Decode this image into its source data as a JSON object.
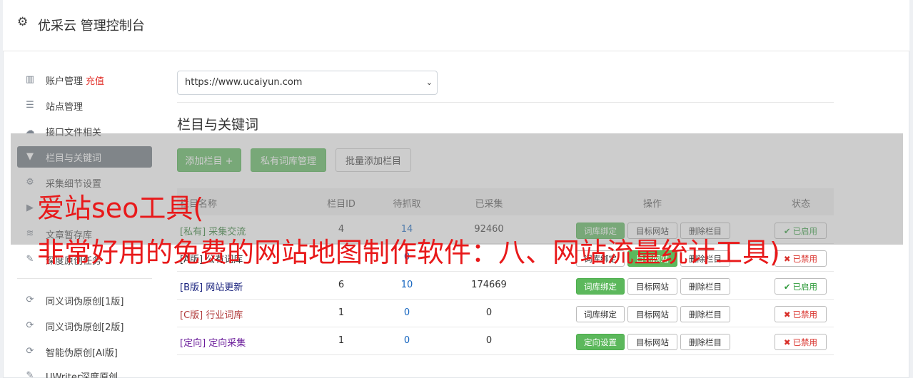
{
  "app": {
    "title": "优采云 管理控制台"
  },
  "sidebar": {
    "items": [
      {
        "label": "账户管理",
        "extra": "充值",
        "icon": "bar-chart-icon",
        "glyph": "▥"
      },
      {
        "label": "站点管理",
        "icon": "server-icon",
        "glyph": "☰"
      },
      {
        "label": "接口文件相关",
        "icon": "cloud-upload-icon",
        "glyph": "☁"
      },
      {
        "label": "栏目与关键词",
        "icon": "filter-icon",
        "glyph": "▼",
        "active": true
      },
      {
        "label": "采集细节设置",
        "icon": "cogs-icon",
        "glyph": "⚙"
      },
      {
        "label": "",
        "icon": "play-circle-icon",
        "glyph": "▶"
      },
      {
        "label": "文章暂存库",
        "icon": "database-icon",
        "glyph": "≋"
      },
      {
        "label": "深度原创任务",
        "icon": "edit-icon",
        "glyph": "✎"
      }
    ],
    "tools": [
      {
        "label": "同义词伪原创[1版]",
        "icon": "refresh-icon",
        "glyph": "⟳"
      },
      {
        "label": "同义词伪原创[2版]",
        "icon": "refresh-icon",
        "glyph": "⟳"
      },
      {
        "label": "智能伪原创[AI版]",
        "icon": "refresh-icon",
        "glyph": "⟳"
      },
      {
        "label": "UWriter深度原创",
        "icon": "edit-icon",
        "glyph": "✎"
      }
    ]
  },
  "main": {
    "site_select": {
      "value": "https://www.ucaiyun.com"
    },
    "section_title": "栏目与关键词",
    "buttons": {
      "add": "添加栏目 +",
      "private": "私有词库管理",
      "batch": "批量添加栏目"
    },
    "table": {
      "headers": [
        "栏目名称",
        "栏目ID",
        "待抓取",
        "已采集",
        "操作",
        "状态"
      ],
      "rows": [
        {
          "tag": "[私有]",
          "name": "采集交流",
          "id": "4",
          "pending": "14",
          "collected": "92460",
          "action1": "词库绑定",
          "action1_style": "green",
          "action2": "目标网站",
          "action2_style": "white",
          "action3": "删除栏目",
          "status": "已启用",
          "status_on": true,
          "color": "#2e7d32"
        },
        {
          "tag": "[A版]",
          "name": "公有词库",
          "id": "",
          "pending": "0",
          "collected": "",
          "action1": "词库绑定",
          "action1_style": "white",
          "action2": "目标网站",
          "action2_style": "green",
          "action3": "删除栏目",
          "status": "已禁用",
          "status_on": false,
          "color": "#333333"
        },
        {
          "tag": "[B版]",
          "name": "网站更新",
          "id": "6",
          "pending": "10",
          "collected": "174669",
          "action1": "词库绑定",
          "action1_style": "green",
          "action2": "目标网站",
          "action2_style": "white",
          "action3": "删除栏目",
          "status": "已启用",
          "status_on": true,
          "color": "#1a237e"
        },
        {
          "tag": "[C版]",
          "name": "行业词库",
          "id": "1",
          "pending": "0",
          "collected": "0",
          "action1": "词库绑定",
          "action1_style": "white",
          "action2": "目标网站",
          "action2_style": "white",
          "action3": "删除栏目",
          "status": "已禁用",
          "status_on": false,
          "color": "#b23c3c"
        },
        {
          "tag": "[定向]",
          "name": "定向采集",
          "id": "1",
          "pending": "0",
          "collected": "0",
          "action1": "定向设置",
          "action1_style": "green",
          "action2": "目标网站",
          "action2_style": "white",
          "action3": "删除栏目",
          "status": "已禁用",
          "status_on": false,
          "color": "#6a1b9a"
        }
      ]
    }
  },
  "overlay": {
    "line1": "爱站seo工具(",
    "line2": "非常好用的免费的网站地图制作软件：八、网站流量统计工具)"
  },
  "colors": {
    "accent_green": "#5cb85c",
    "active_side": "#6c757d",
    "overlay_text": "#e8191a"
  }
}
